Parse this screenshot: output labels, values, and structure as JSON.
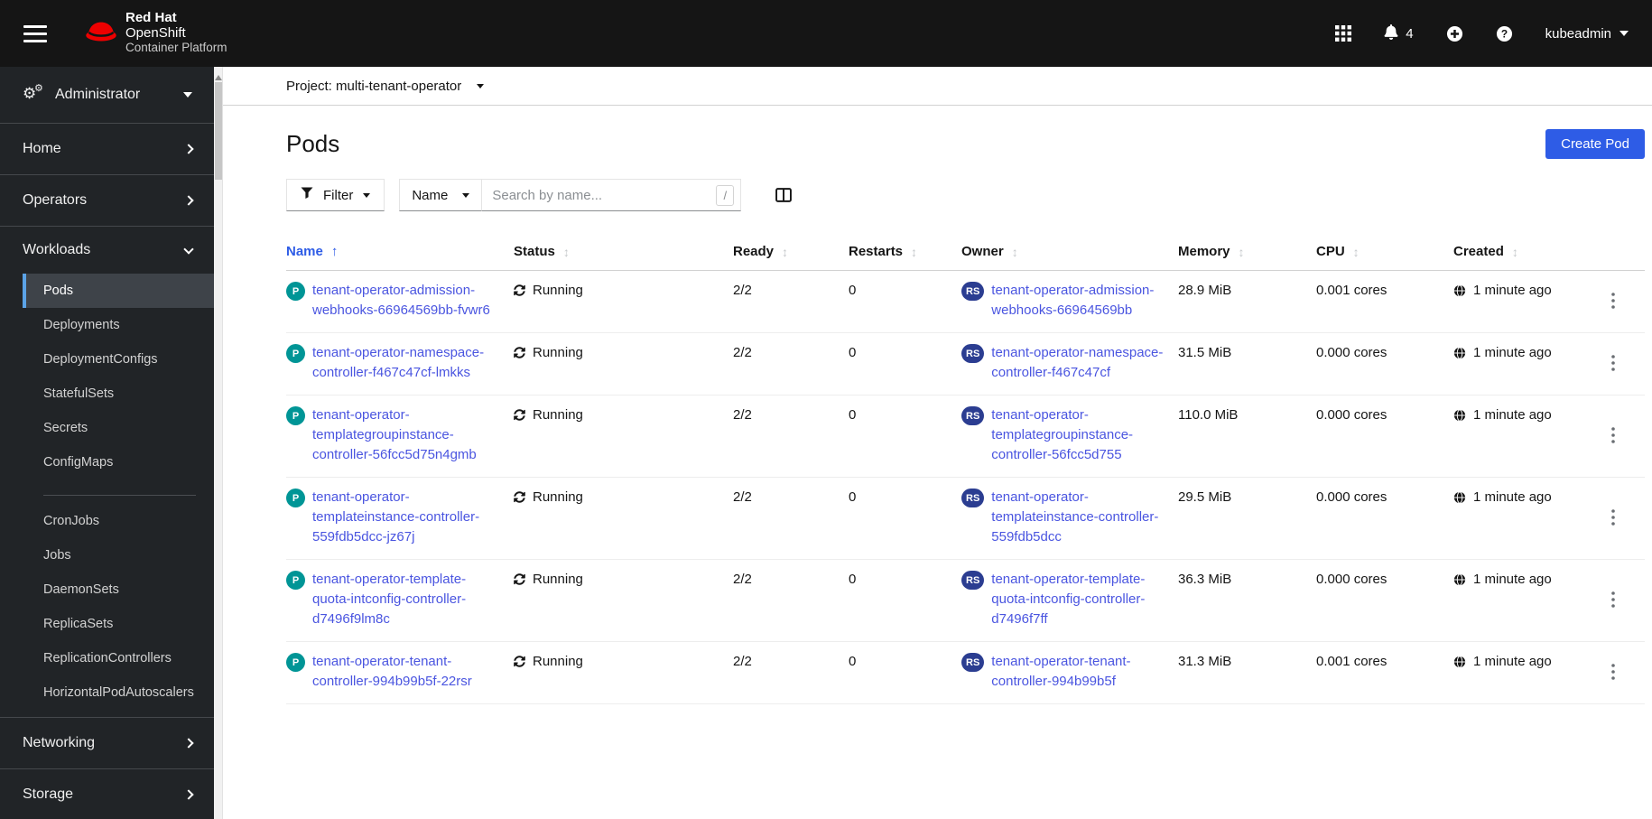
{
  "masthead": {
    "brand_line1": "Red Hat",
    "brand_line2": "OpenShift",
    "brand_line3": "Container Platform",
    "notification_count": "4",
    "username": "kubeadmin"
  },
  "sidebar": {
    "perspective": "Administrator",
    "sections": {
      "home": "Home",
      "operators": "Operators",
      "workloads": "Workloads",
      "networking": "Networking",
      "storage": "Storage"
    },
    "workloads_items": [
      "Pods",
      "Deployments",
      "DeploymentConfigs",
      "StatefulSets",
      "Secrets",
      "ConfigMaps"
    ],
    "workloads_items_2": [
      "CronJobs",
      "Jobs",
      "DaemonSets",
      "ReplicaSets",
      "ReplicationControllers",
      "HorizontalPodAutoscalers"
    ],
    "active_item": "Pods"
  },
  "project_bar": {
    "label": "Project: multi-tenant-operator"
  },
  "page": {
    "title": "Pods",
    "create_button_label": "Create Pod"
  },
  "toolbar": {
    "filter_label": "Filter",
    "attribute_selector_value": "Name",
    "search_placeholder": "Search by name...",
    "search_shortcut": "/"
  },
  "table": {
    "columns": [
      "Name",
      "Status",
      "Ready",
      "Restarts",
      "Owner",
      "Memory",
      "CPU",
      "Created"
    ],
    "sorted_column": "Name",
    "pod_badge": "P",
    "owner_badge": "RS",
    "rows": [
      {
        "name": "tenant-operator-admission-webhooks-66964569bb-fvwr6",
        "status": "Running",
        "ready": "2/2",
        "restarts": "0",
        "owner": "tenant-operator-admission-webhooks-66964569bb",
        "memory": "28.9 MiB",
        "cpu": "0.001 cores",
        "created": "1 minute ago"
      },
      {
        "name": "tenant-operator-namespace-controller-f467c47cf-lmkks",
        "status": "Running",
        "ready": "2/2",
        "restarts": "0",
        "owner": "tenant-operator-namespace-controller-f467c47cf",
        "memory": "31.5 MiB",
        "cpu": "0.000 cores",
        "created": "1 minute ago"
      },
      {
        "name": "tenant-operator-templategroupinstance-controller-56fcc5d75n4gmb",
        "status": "Running",
        "ready": "2/2",
        "restarts": "0",
        "owner": "tenant-operator-templategroupinstance-controller-56fcc5d755",
        "memory": "110.0 MiB",
        "cpu": "0.000 cores",
        "created": "1 minute ago"
      },
      {
        "name": "tenant-operator-templateinstance-controller-559fdb5dcc-jz67j",
        "status": "Running",
        "ready": "2/2",
        "restarts": "0",
        "owner": "tenant-operator-templateinstance-controller-559fdb5dcc",
        "memory": "29.5 MiB",
        "cpu": "0.000 cores",
        "created": "1 minute ago"
      },
      {
        "name": "tenant-operator-template-quota-intconfig-controller-d7496f9lm8c",
        "status": "Running",
        "ready": "2/2",
        "restarts": "0",
        "owner": "tenant-operator-template-quota-intconfig-controller-d7496f7ff",
        "memory": "36.3 MiB",
        "cpu": "0.000 cores",
        "created": "1 minute ago"
      },
      {
        "name": "tenant-operator-tenant-controller-994b99b5f-22rsr",
        "status": "Running",
        "ready": "2/2",
        "restarts": "0",
        "owner": "tenant-operator-tenant-controller-994b99b5f",
        "memory": "31.3 MiB",
        "cpu": "0.001 cores",
        "created": "1 minute ago"
      }
    ]
  },
  "colors": {
    "masthead_bg": "#151515",
    "sidebar_bg": "#212427",
    "nav_active_border": "#5ba3e7",
    "nav_active_bg": "#3e4349",
    "primary_button": "#2e5ce6",
    "link": "#4a55e0",
    "pod_badge_bg": "#009596",
    "owner_badge_bg": "#2b3d91",
    "brand_red": "#ee0000"
  }
}
